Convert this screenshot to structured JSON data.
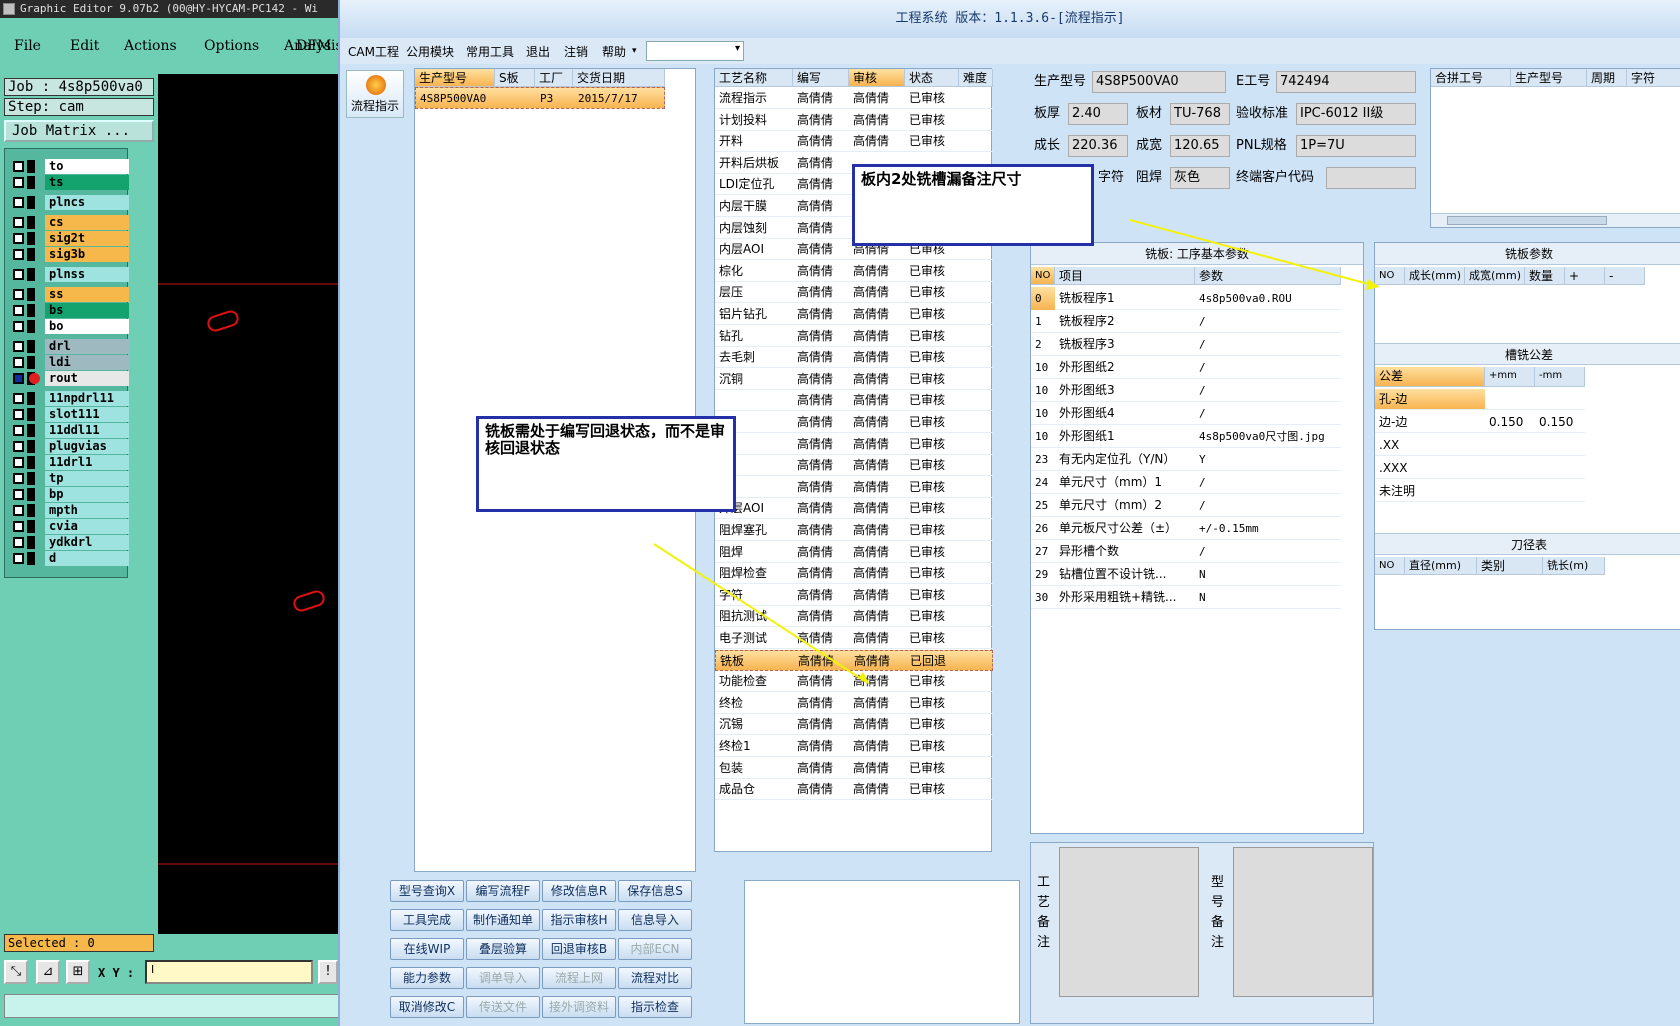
{
  "editor": {
    "title": "Graphic Editor 9.07b2 (00@HY-HYCAM-PC142 - Wi",
    "menu": [
      "File",
      "Edit",
      "Actions",
      "Options",
      "Analysis",
      "DFM"
    ],
    "job": "Job : 4s8p500va0",
    "step": "Step: cam",
    "job_matrix": "Job Matrix ...",
    "layers": [
      {
        "name": "to",
        "color": "#ffffff"
      },
      {
        "name": "ts",
        "color": "#14a36f"
      },
      {
        "name": "plncs",
        "color": "#9fe3e0"
      },
      {
        "name": "cs",
        "color": "#f6b84a"
      },
      {
        "name": "sig2t",
        "color": "#f6b84a"
      },
      {
        "name": "sig3b",
        "color": "#f6b84a"
      },
      {
        "name": "plnss",
        "color": "#9fe3e0"
      },
      {
        "name": "ss",
        "color": "#f6b84a"
      },
      {
        "name": "bs",
        "color": "#14a36f"
      },
      {
        "name": "bo",
        "color": "#ffffff"
      },
      {
        "name": "drl",
        "color": "#9fb9c0"
      },
      {
        "name": "ldi",
        "color": "#9fb9c0"
      },
      {
        "name": "rout",
        "color": "#e8e8e8"
      },
      {
        "name": "11npdrl11",
        "color": "#9fe3e0"
      },
      {
        "name": "slot111",
        "color": "#9fe3e0"
      },
      {
        "name": "11ddl11",
        "color": "#9fe3e0"
      },
      {
        "name": "plugvias",
        "color": "#9fe3e0"
      },
      {
        "name": "11drl1",
        "color": "#9fe3e0"
      },
      {
        "name": "tp",
        "color": "#9fe3e0"
      },
      {
        "name": "bp",
        "color": "#9fe3e0"
      },
      {
        "name": "mpth",
        "color": "#9fe3e0"
      },
      {
        "name": "cvia",
        "color": "#9fe3e0"
      },
      {
        "name": "ydkdrl",
        "color": "#9fe3e0"
      },
      {
        "name": "d",
        "color": "#9fe3e0"
      }
    ],
    "selected": "Selected : 0",
    "xy_label": "X Y :",
    "xy_value": "I"
  },
  "app": {
    "title": "工程系统 版本：1.1.3.6-[流程指示]",
    "menu": [
      "CAM工程",
      "公用模块",
      "常用工具",
      "退出",
      "注销",
      "帮助"
    ],
    "flow_button": "流程指示",
    "model_table": {
      "headers": [
        "生产型号",
        "S板",
        "工厂",
        "交货日期"
      ],
      "rows": [
        [
          "4S8P500VA0",
          "",
          "P3",
          "2015/7/17"
        ]
      ]
    },
    "process_table": {
      "headers": [
        "工艺名称",
        "编写",
        "审核",
        "状态",
        "难度"
      ],
      "rows": [
        [
          "流程指示",
          "高倩倩",
          "高倩倩",
          "已审核",
          ""
        ],
        [
          "计划投料",
          "高倩倩",
          "高倩倩",
          "已审核",
          ""
        ],
        [
          "开料",
          "高倩倩",
          "高倩倩",
          "已审核",
          ""
        ],
        [
          "开料后烘板",
          "高倩倩",
          "",
          "",
          ""
        ],
        [
          "LDI定位孔",
          "高倩倩",
          "",
          "",
          ""
        ],
        [
          "内层干膜",
          "高倩倩",
          "",
          "",
          ""
        ],
        [
          "内层蚀刻",
          "高倩倩",
          "",
          "",
          ""
        ],
        [
          "内层AOI",
          "高倩倩",
          "高倩倩",
          "已审核",
          ""
        ],
        [
          "棕化",
          "高倩倩",
          "高倩倩",
          "已审核",
          ""
        ],
        [
          "层压",
          "高倩倩",
          "高倩倩",
          "已审核",
          ""
        ],
        [
          "铝片钻孔",
          "高倩倩",
          "高倩倩",
          "已审核",
          ""
        ],
        [
          "钻孔",
          "高倩倩",
          "高倩倩",
          "已审核",
          ""
        ],
        [
          "去毛刺",
          "高倩倩",
          "高倩倩",
          "已审核",
          ""
        ],
        [
          "沉铜",
          "高倩倩",
          "高倩倩",
          "已审核",
          ""
        ],
        [
          "",
          "高倩倩",
          "高倩倩",
          "已审核",
          ""
        ],
        [
          "",
          "高倩倩",
          "高倩倩",
          "已审核",
          ""
        ],
        [
          "",
          "高倩倩",
          "高倩倩",
          "已审核",
          ""
        ],
        [
          "",
          "高倩倩",
          "高倩倩",
          "已审核",
          ""
        ],
        [
          "",
          "高倩倩",
          "高倩倩",
          "已审核",
          ""
        ],
        [
          "外层AOI",
          "高倩倩",
          "高倩倩",
          "已审核",
          ""
        ],
        [
          "阻焊塞孔",
          "高倩倩",
          "高倩倩",
          "已审核",
          ""
        ],
        [
          "阻焊",
          "高倩倩",
          "高倩倩",
          "已审核",
          ""
        ],
        [
          "阻焊检查",
          "高倩倩",
          "高倩倩",
          "已审核",
          ""
        ],
        [
          "字符",
          "高倩倩",
          "高倩倩",
          "已审核",
          ""
        ],
        [
          "阻抗测试",
          "高倩倩",
          "高倩倩",
          "已审核",
          ""
        ],
        [
          "电子测试",
          "高倩倩",
          "高倩倩",
          "已审核",
          ""
        ],
        [
          "铣板",
          "高倩倩",
          "高倩倩",
          "已回退",
          ""
        ],
        [
          "功能检查",
          "高倩倩",
          "高倩倩",
          "已审核",
          ""
        ],
        [
          "终检",
          "高倩倩",
          "高倩倩",
          "已审核",
          ""
        ],
        [
          "沉锡",
          "高倩倩",
          "高倩倩",
          "已审核",
          ""
        ],
        [
          "终检1",
          "高倩倩",
          "高倩倩",
          "已审核",
          ""
        ],
        [
          "包装",
          "高倩倩",
          "高倩倩",
          "已审核",
          ""
        ],
        [
          "成品仓",
          "高倩倩",
          "高倩倩",
          "已审核",
          ""
        ]
      ],
      "selected_index": 26
    },
    "buttons": [
      [
        "型号查询X",
        "编写流程F",
        "修改信息R",
        "保存信息S"
      ],
      [
        "工具完成",
        "制作通知单",
        "指示审核H",
        "信息导入"
      ],
      [
        "在线WIP",
        "叠层验算",
        "回退审核B",
        "内部ECN"
      ],
      [
        "能力参数",
        "调单导入",
        "流程上网",
        "流程对比"
      ],
      [
        "取消修改C",
        "传送文件",
        "接外调资料",
        "指示检查"
      ]
    ],
    "disabled_buttons": [
      "内部ECN",
      "调单导入",
      "流程上网",
      "传送文件",
      "接外调资料"
    ],
    "info": {
      "prod_model_label": "生产型号",
      "prod_model": "4S8P500VA0",
      "e_no_label": "E工号",
      "e_no": "742494",
      "thickness_label": "板厚",
      "thickness": "2.40",
      "material_label": "板材",
      "material": "TU-768",
      "standard_label": "验收标准",
      "standard": "IPC-6012 II级",
      "length_label": "成长",
      "length": "220.36",
      "width_label": "成宽",
      "width": "120.65",
      "pnl_label": "PNL规格",
      "pnl": "1P=7U",
      "char_label": "字符",
      "solder_label": "阻焊",
      "solder": "灰色",
      "customer_code_label": "终端客户代码",
      "customer_code": ""
    },
    "merge_table": {
      "headers": [
        "合拼工号",
        "生产型号",
        "周期",
        "字符"
      ]
    },
    "params": {
      "title": "铣板: 工序基本参数",
      "headers": [
        "NO",
        "项目",
        "参数"
      ],
      "rows": [
        [
          "0",
          "铣板程序1",
          "4s8p500va0.ROU"
        ],
        [
          "1",
          "铣板程序2",
          "/"
        ],
        [
          "2",
          "铣板程序3",
          "/"
        ],
        [
          "10",
          "外形图纸2",
          "/"
        ],
        [
          "10",
          "外形图纸3",
          "/"
        ],
        [
          "10",
          "外形图纸4",
          "/"
        ],
        [
          "10",
          "外形图纸1",
          "4s8p500va0尺寸图.jpg"
        ],
        [
          "23",
          "有无内定位孔（Y/N）",
          "Y"
        ],
        [
          "24",
          "单元尺寸（mm）1",
          "/"
        ],
        [
          "25",
          "单元尺寸（mm）2",
          "/"
        ],
        [
          "26",
          "单元板尺寸公差（±）",
          "+/-0.15mm"
        ],
        [
          "27",
          "异形槽个数",
          "/"
        ],
        [
          "29",
          "钻槽位置不设计铣...",
          "N"
        ],
        [
          "30",
          "外形采用粗铣+精铣...",
          "N"
        ]
      ]
    },
    "mill_params": {
      "title": "铣板参数",
      "headers": [
        "NO",
        "成长(mm)",
        "成宽(mm)",
        "数量",
        "+",
        "-"
      ]
    },
    "slot_tol": {
      "title": "槽铣公差",
      "headers": [
        "公差",
        "+mm",
        "-mm"
      ],
      "rows": [
        [
          "孔-边",
          "",
          ""
        ],
        [
          "边-边",
          "0.150",
          "0.150"
        ],
        [
          ".XX",
          "",
          ""
        ],
        [
          ".XXX",
          "",
          ""
        ],
        [
          "未注明",
          "",
          ""
        ]
      ]
    },
    "tool_table": {
      "title": "刀径表",
      "headers": [
        "NO",
        "直径(mm)",
        "类别",
        "铣长(m)"
      ]
    },
    "remark_process": "工艺备注",
    "remark_model": "型号备注",
    "callout1": "板内2处铣槽漏备注尺寸",
    "callout2": "铣板需处于编写回退状态，而不是审核回退状态"
  }
}
